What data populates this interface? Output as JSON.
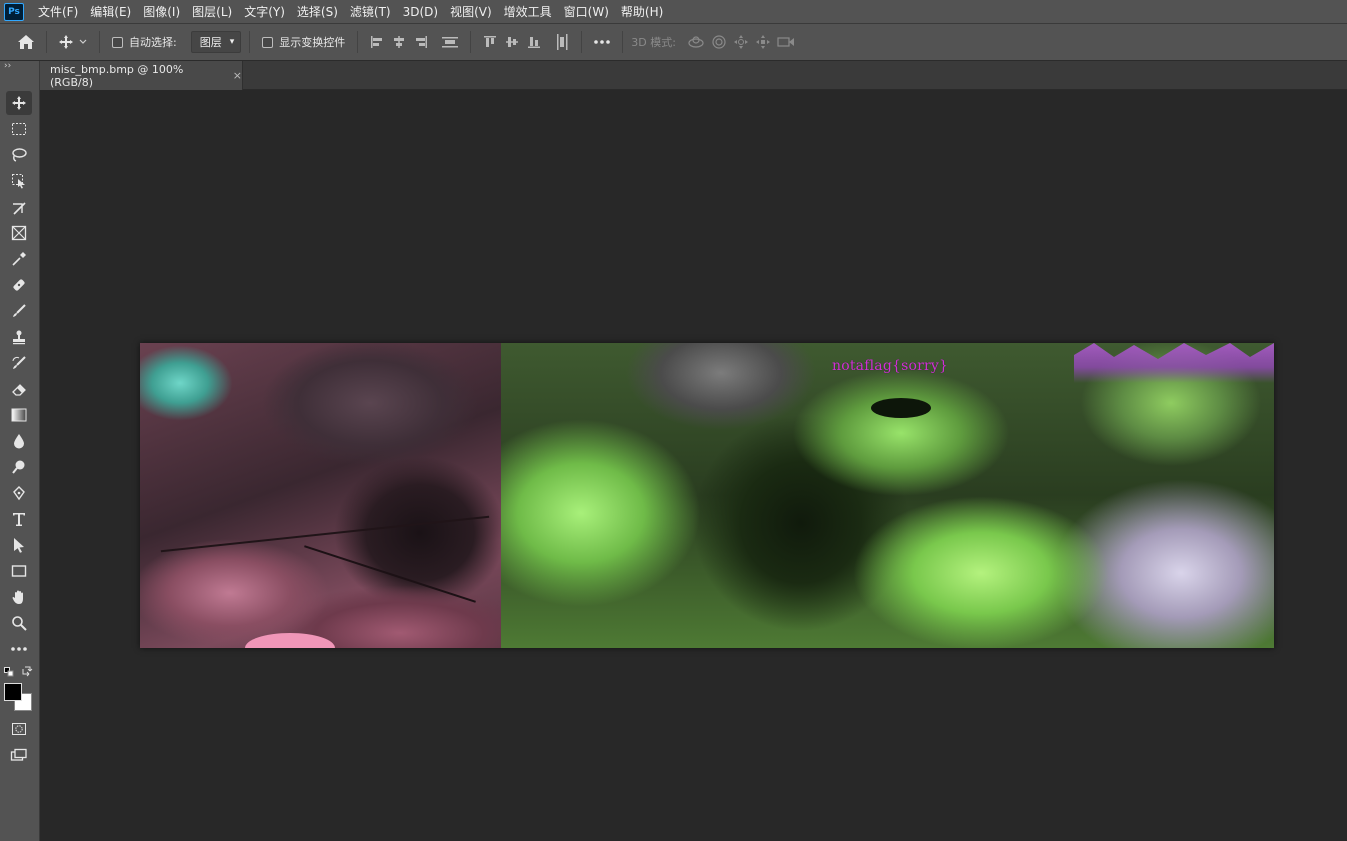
{
  "app": {
    "logo": "Ps"
  },
  "menu": {
    "items": [
      "文件(F)",
      "编辑(E)",
      "图像(I)",
      "图层(L)",
      "文字(Y)",
      "选择(S)",
      "滤镜(T)",
      "3D(D)",
      "视图(V)",
      "增效工具",
      "窗口(W)",
      "帮助(H)"
    ]
  },
  "options": {
    "auto_select_label": "自动选择:",
    "layer_select_value": "图层",
    "show_transform_label": "显示变换控件",
    "mode_3d_label": "3D 模式:"
  },
  "document": {
    "tab_title": "misc_bmp.bmp @ 100%(RGB/8)",
    "close_glyph": "×"
  },
  "canvas": {
    "overlay_text": "notaflag{sorry}"
  },
  "toolbar": {
    "tools": [
      "move-tool",
      "marquee-tool",
      "lasso-tool",
      "object-select-tool",
      "crop-tool",
      "frame-tool",
      "eyedropper-tool",
      "healing-brush-tool",
      "brush-tool",
      "clone-stamp-tool",
      "history-brush-tool",
      "eraser-tool",
      "gradient-tool",
      "blur-tool",
      "dodge-tool",
      "pen-tool",
      "type-tool",
      "path-select-tool",
      "rectangle-tool",
      "hand-tool",
      "zoom-tool",
      "more-tools"
    ],
    "foreground_color": "#000000",
    "background_color": "#ffffff"
  }
}
